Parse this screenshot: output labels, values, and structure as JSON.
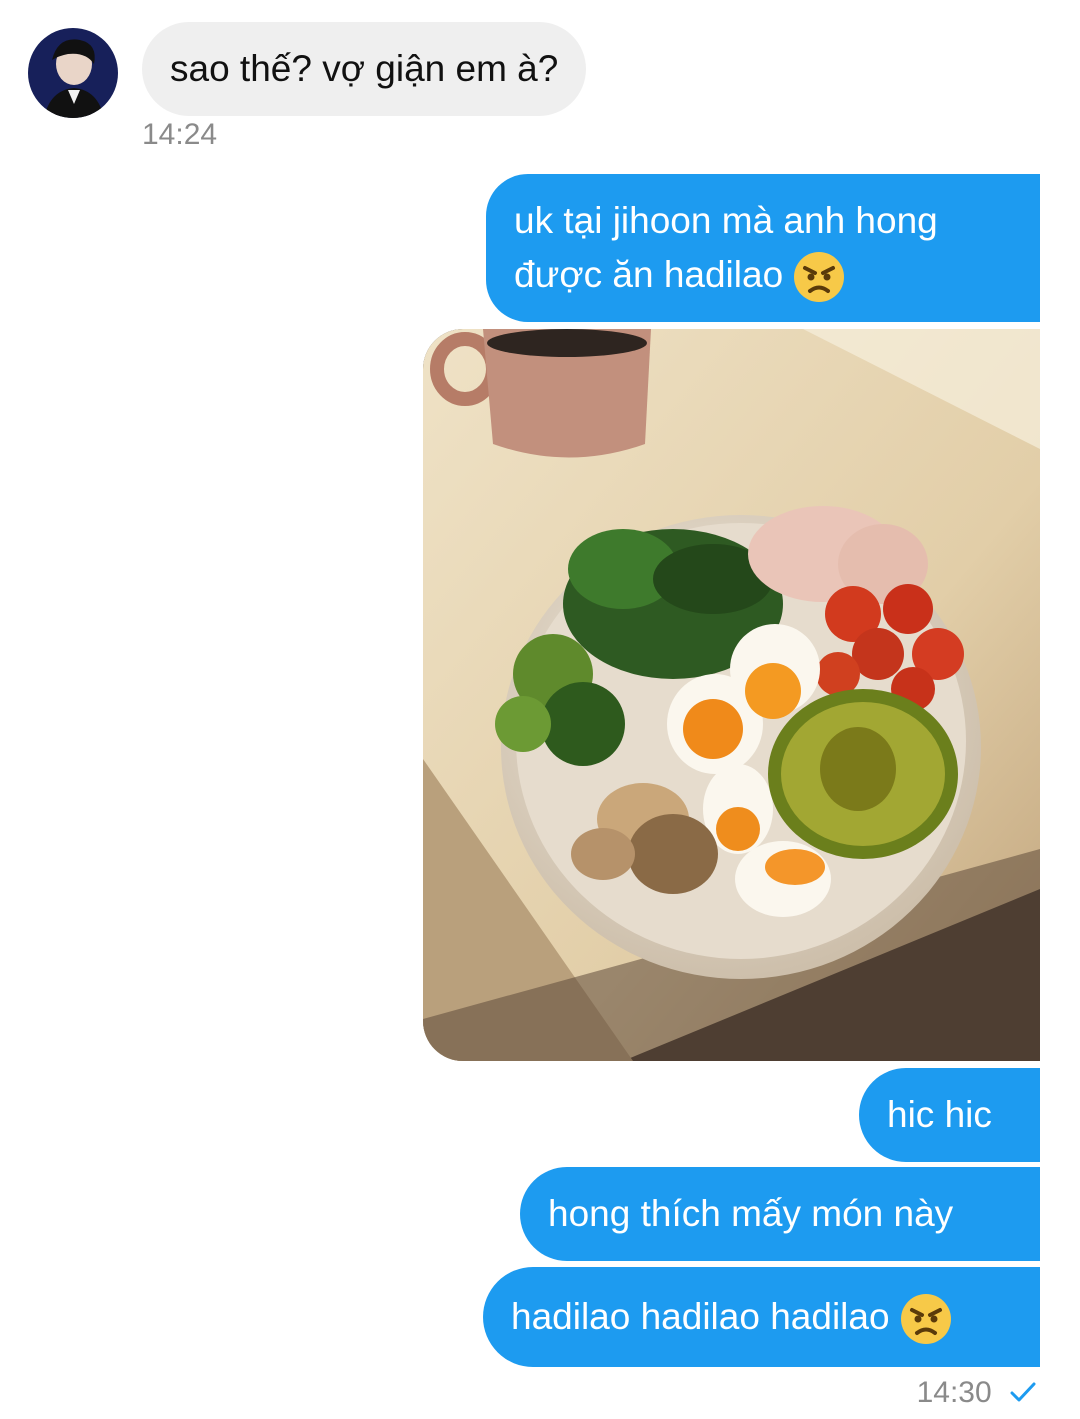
{
  "messages": [
    {
      "text": "sao thế? vợ giận em à?",
      "time": "14:24"
    },
    {
      "line1": "uk tại jihoon mà anh hong",
      "line2": "được ăn hadilao",
      "emoji": "angry-face"
    },
    {
      "image": "salad-bowl-photo"
    },
    {
      "text": "hic hic"
    },
    {
      "text": "hong thích mấy món này"
    },
    {
      "text": "hadilao hadilao hadilao",
      "emoji": "angry-face",
      "time": "14:30",
      "status": "read-check"
    }
  ],
  "colors": {
    "outgoing_bubble": "#1d9bf0",
    "incoming_bubble": "#efefef",
    "timestamp": "#8a8a8a",
    "read_check": "#1d9bf0"
  }
}
